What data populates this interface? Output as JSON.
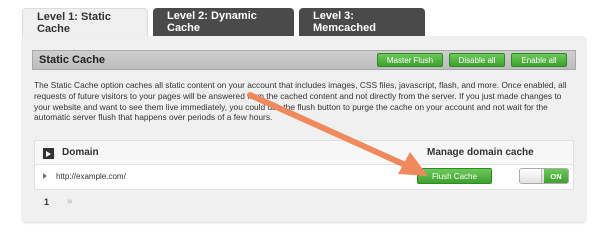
{
  "tabs": [
    {
      "label": "Level 1: Static Cache",
      "active": true
    },
    {
      "label": "Level 2: Dynamic Cache",
      "active": false
    },
    {
      "label": "Level 3: Memcached",
      "active": false
    }
  ],
  "header": {
    "title": "Static Cache",
    "master_flush": "Master Flush",
    "disable_all": "Disable all",
    "enable_all": "Enable all"
  },
  "description": "The Static Cache option caches all static content on your account that includes images, CSS files, javascript, flash, and more. Once enabled, all requests of future visitors to your pages will be answered from the cached content and not directly from the server. If you just made changes to your website and want to see them live immediately, you could use the flush button to purge the cache on your account and not wait for the automatic server flush that happens over periods of a few hours.",
  "table": {
    "col_domain": "Domain",
    "col_manage": "Manage domain cache",
    "rows": [
      {
        "domain": "http://example.com/",
        "flush_label": "Flush Cache",
        "toggle_label": "ON"
      }
    ]
  },
  "pager": {
    "current": "1",
    "next": "»"
  },
  "colors": {
    "accent_green": "#46a83a",
    "arrow": "#f08a5d",
    "tab_dark": "#4a4a4a"
  }
}
